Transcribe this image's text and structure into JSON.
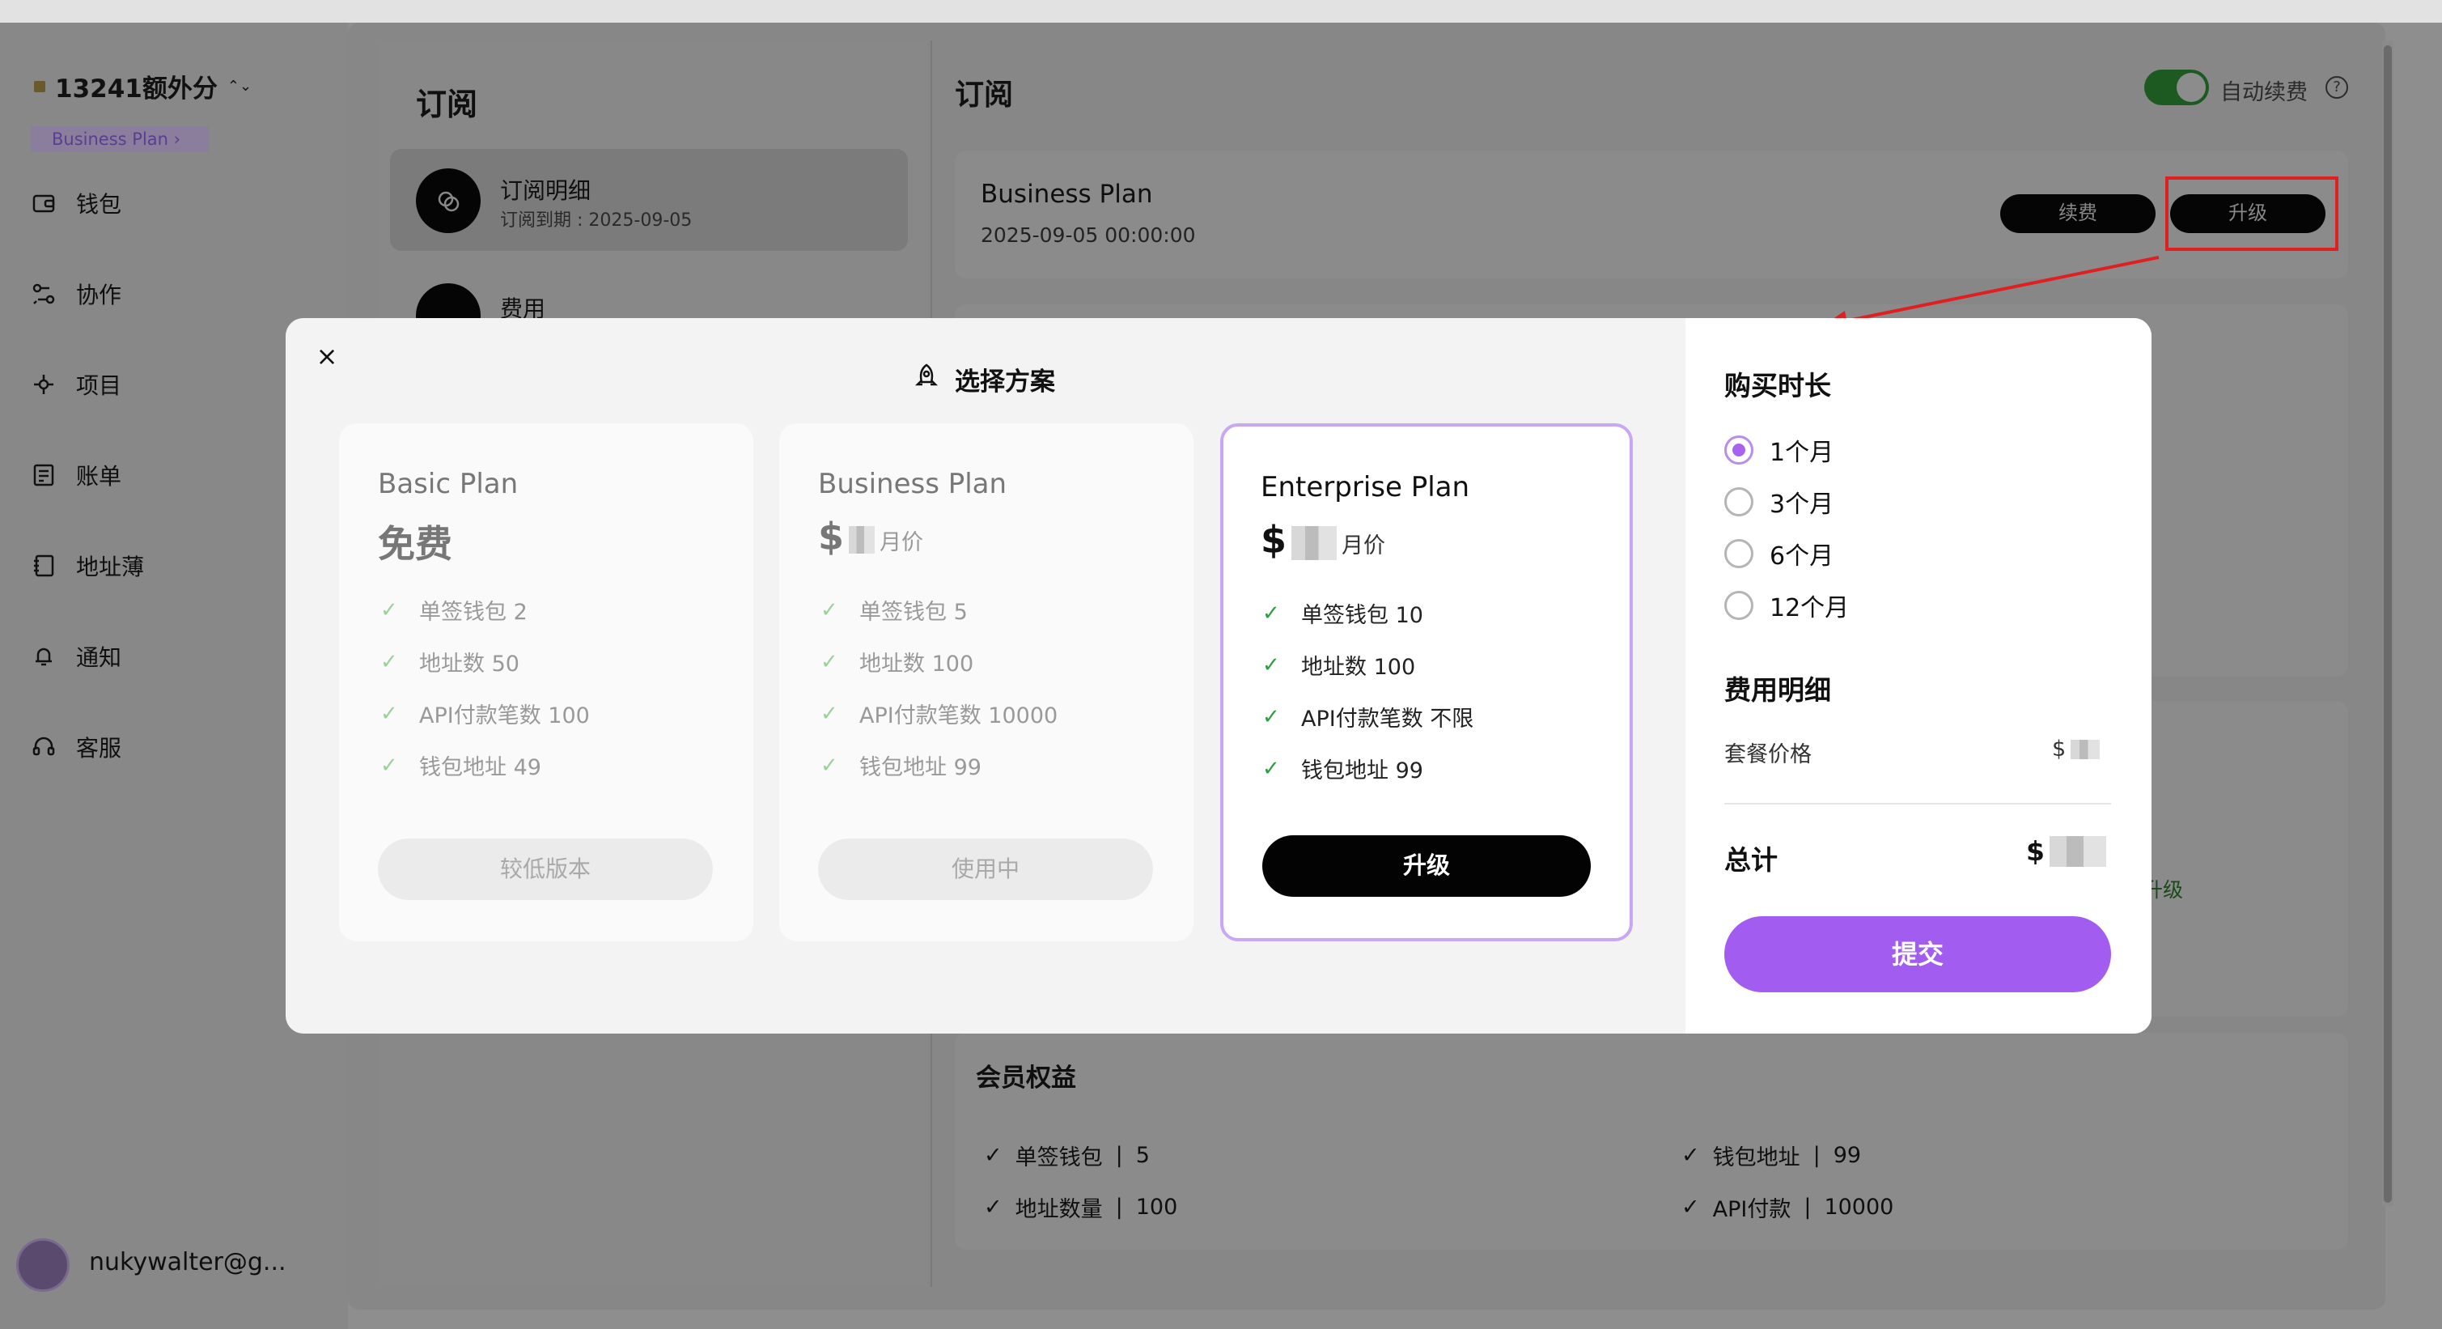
{
  "sidebar": {
    "workspace": "13241额外分",
    "plan_badge": "Business Plan",
    "badge_chevron": "›",
    "switch_chevron": "⌃⌄",
    "items": [
      {
        "label": "钱包",
        "icon": "wallet-icon"
      },
      {
        "label": "协作",
        "icon": "collaboration-icon"
      },
      {
        "label": "项目",
        "icon": "project-icon"
      },
      {
        "label": "账单",
        "icon": "bill-icon"
      },
      {
        "label": "地址薄",
        "icon": "address-book-icon"
      },
      {
        "label": "通知",
        "icon": "bell-icon"
      },
      {
        "label": "客服",
        "icon": "headset-icon"
      }
    ],
    "user_email": "nukywalter@g..."
  },
  "subscription_nav": {
    "title": "订阅",
    "detail_title": "订阅明细",
    "detail_date": "订阅到期 : 2025-09-05",
    "fee_title": "费用"
  },
  "subscription_main": {
    "title": "订阅",
    "auto_renew_label": "自动续费",
    "auto_renew_on": true,
    "help_glyph": "?",
    "plan_name": "Business Plan",
    "plan_date": "2025-09-05 00:00:00",
    "renew_button": "续费",
    "upgrade_button": "升级",
    "bg_upgrade_text": "升级",
    "benefits_title": "会员权益",
    "benefits": [
      {
        "label": "单签钱包",
        "value": "5"
      },
      {
        "label": "钱包地址",
        "value": "99"
      },
      {
        "label": "地址数量",
        "value": "100"
      },
      {
        "label": "API付款",
        "value": "10000"
      }
    ],
    "separator": "|"
  },
  "modal": {
    "close_glyph": "×",
    "title": "选择方案",
    "plans": [
      {
        "name": "Basic Plan",
        "price": "免费",
        "features": [
          "单签钱包 2",
          "地址数 50",
          "API付款笔数 100",
          "钱包地址 49"
        ],
        "button": "较低版本"
      },
      {
        "name": "Business Plan",
        "price_symbol": "$",
        "price_unit": "月价",
        "features": [
          "单签钱包 5",
          "地址数 100",
          "API付款笔数 10000",
          "钱包地址 99"
        ],
        "button": "使用中"
      },
      {
        "name": "Enterprise Plan",
        "price_symbol": "$",
        "price_unit": "月价",
        "features": [
          "单签钱包 10",
          "地址数 100",
          "API付款笔数 不限",
          "钱包地址 99"
        ],
        "button": "升级"
      }
    ],
    "duration_title": "购买时长",
    "durations": [
      {
        "label": "1个月",
        "selected": true
      },
      {
        "label": "3个月",
        "selected": false
      },
      {
        "label": "6个月",
        "selected": false
      },
      {
        "label": "12个月",
        "selected": false
      }
    ],
    "fee_title": "费用明细",
    "package_price_label": "套餐价格",
    "package_price_symbol": "$",
    "total_label": "总计",
    "total_symbol": "$",
    "submit_button": "提交",
    "check_glyph": "✓"
  },
  "colors": {
    "accent_purple": "#a35cf0",
    "annotation_red": "#e02020",
    "check_green": "#2e9e3e",
    "toggle_green": "#1c5a22"
  }
}
